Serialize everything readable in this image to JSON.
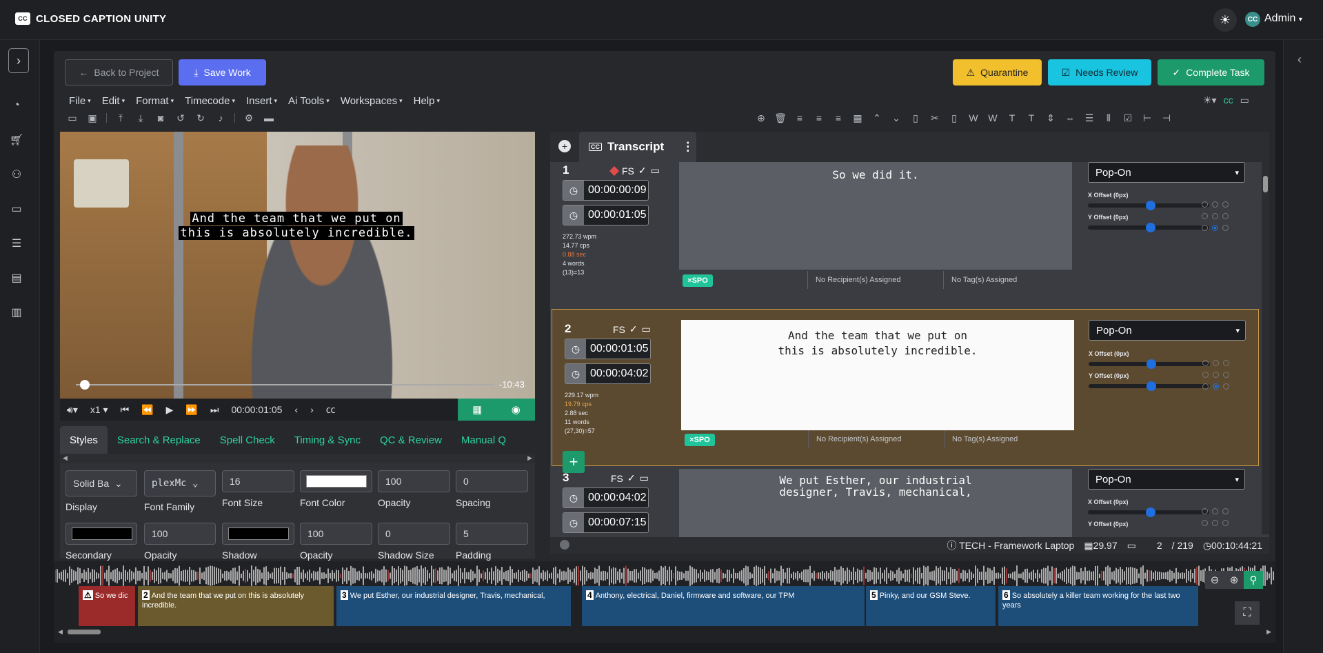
{
  "app": {
    "title": "CLOSED CAPTION UNITY",
    "logo_text": "CC",
    "user_initials": "CC",
    "user_name": "Admin",
    "theme_icon": "sun-icon"
  },
  "header_actions": {
    "back": "Back to Project",
    "save": "Save Work",
    "quarantine": "Quarantine",
    "needs_review": "Needs Review",
    "complete": "Complete Task",
    "colors": {
      "save": "#5b6ef0",
      "quarantine": "#f2bf2d",
      "needs_review": "#19c4e0",
      "complete": "#1c9a6c"
    }
  },
  "menu": [
    "File",
    "Edit",
    "Format",
    "Timecode",
    "Insert",
    "Ai Tools",
    "Workspaces",
    "Help"
  ],
  "video": {
    "caption_line1": "And the team that we put on",
    "caption_line2": "this is absolutely incredible.",
    "time_remaining": "-10:43",
    "speed": "x1",
    "current_time": "00:00:01:05",
    "progress": 0.02
  },
  "tabs": [
    "Styles",
    "Search & Replace",
    "Spell Check",
    "Timing & Sync",
    "QC & Review",
    "Manual Q"
  ],
  "styles": {
    "display": {
      "value": "Solid Ba",
      "label": "Display"
    },
    "font_family": {
      "value": "plexMc",
      "label": "Font Family"
    },
    "font_size": {
      "value": "16",
      "label": "Font Size"
    },
    "font_color": {
      "label": "Font Color",
      "color": "#ffffff"
    },
    "opacity1": {
      "value": "100",
      "label": "Opacity"
    },
    "spacing": {
      "value": "0",
      "label": "Spacing"
    },
    "secondary": {
      "label": "Secondary",
      "color": "#000000"
    },
    "opacity2": {
      "value": "100",
      "label": "Opacity"
    },
    "shadow": {
      "label": "Shadow",
      "color": "#000000"
    },
    "opacity3": {
      "value": "100",
      "label": "Opacity"
    },
    "shadow_size": {
      "value": "0",
      "label": "Shadow Size"
    },
    "padding": {
      "value": "5",
      "label": "Padding"
    }
  },
  "transcript": {
    "tab_label": "Transcript",
    "cc_badge": "CC",
    "cues": [
      {
        "num": "1",
        "flag": "FS",
        "start": "00:00:00:09",
        "end": "00:00:01:05",
        "stats": [
          "272.73 wpm",
          "14.77 cps",
          "0.88 sec",
          "4 words",
          "(13)=13"
        ],
        "text": "So we did it.",
        "tag": "SPO",
        "recipient": "No Recipient(s) Assigned",
        "tags": "No Tag(s) Assigned",
        "mode": "Pop-On",
        "x_offset": "X Offset (0px)",
        "y_offset": "Y Offset (0px)"
      },
      {
        "num": "2",
        "flag": "FS",
        "start": "00:00:01:05",
        "end": "00:00:04:02",
        "stats": [
          "229.17 wpm",
          "19.79 cps",
          "2.88 sec",
          "11 words",
          "(27,30)=57"
        ],
        "text": "And the team that we put on\nthis is absolutely incredible.",
        "tag": "SPO",
        "recipient": "No Recipient(s) Assigned",
        "tags": "No Tag(s) Assigned",
        "mode": "Pop-On",
        "x_offset": "X Offset (0px)",
        "y_offset": "Y Offset (0px)"
      },
      {
        "num": "3",
        "flag": "FS",
        "start": "00:00:04:02",
        "end": "00:00:07:15",
        "text": "We put Esther, our industrial\ndesigner, Travis, mechanical,",
        "mode": "Pop-On",
        "x_offset": "X Offset (0px)",
        "y_offset": "Y Offset (0px)"
      }
    ]
  },
  "status": {
    "device": "TECH - Framework Laptop",
    "fps": "29.97",
    "page": "2",
    "total": "/ 219",
    "duration": "00:10:44:21"
  },
  "timeline": {
    "regions": [
      {
        "num": "1",
        "text": "So we dic"
      },
      {
        "num": "2",
        "text": "And the team that we put on this is absolutely incredible."
      },
      {
        "num": "3",
        "text": "We put Esther, our industrial designer, Travis, mechanical,"
      },
      {
        "num": "4",
        "text": "Anthony, electrical, Daniel, firmware and software, our TPM"
      },
      {
        "num": "5",
        "text": "Pinky, and our GSM Steve."
      },
      {
        "num": "6",
        "text": "So absolutely a killer team working for the last two years"
      }
    ]
  }
}
